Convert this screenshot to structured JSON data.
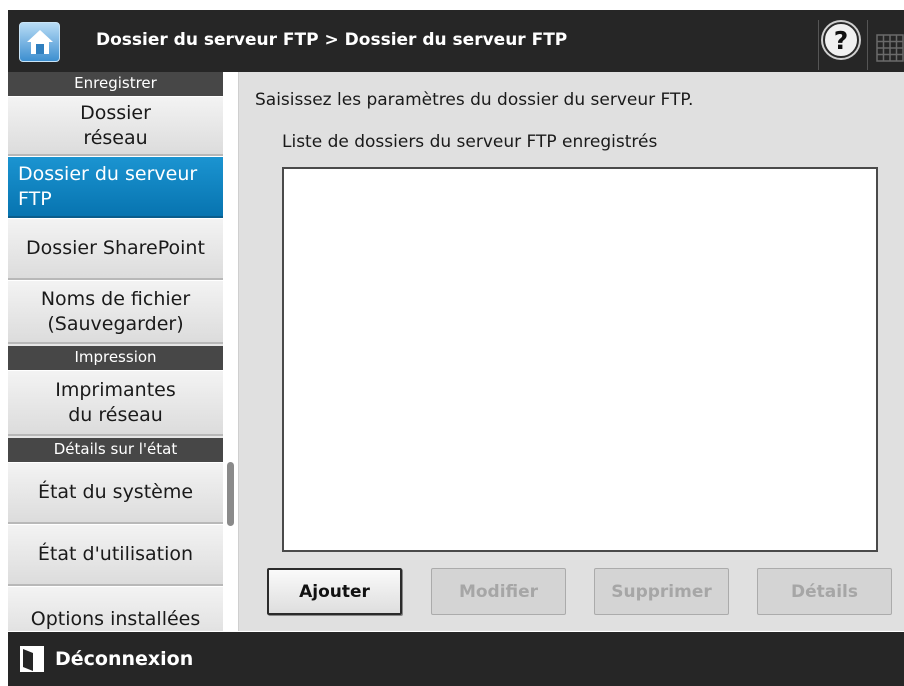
{
  "header": {
    "breadcrumb": "Dossier du serveur FTP  >  Dossier du serveur FTP",
    "help_symbol": "?",
    "icons": [
      "home-icon",
      "help-icon",
      "keyboard-icon"
    ]
  },
  "sidebar": {
    "sections": [
      {
        "header": "Enregistrer",
        "items": [
          "Dossier réseau",
          "Dossier du serveur FTP",
          "Dossier SharePoint",
          "Noms de fichier (Sauvegarder)"
        ]
      },
      {
        "header": "Impression",
        "items": [
          "Imprimantes du réseau"
        ]
      },
      {
        "header": "Détails sur l'état",
        "items": [
          "État du système",
          "État d'utilisation",
          "Options installées"
        ]
      }
    ],
    "active_item": "Dossier du serveur FTP",
    "labels": {
      "enregistrer": "Enregistrer",
      "dossier_reseau_1": "Dossier",
      "dossier_reseau_2": "réseau",
      "dossier_ftp_1": "Dossier du serveur",
      "dossier_ftp_2": "FTP",
      "dossier_sharepoint": "Dossier SharePoint",
      "noms_fichier_1": "Noms de fichier",
      "noms_fichier_2": "(Sauvegarder)",
      "impression": "Impression",
      "imprimantes_1": "Imprimantes",
      "imprimantes_2": "du réseau",
      "details_etat": "Détails sur l'état",
      "etat_systeme": "État du système",
      "etat_utilisation": "État d'utilisation",
      "options_installees": "Options installées"
    }
  },
  "main": {
    "instruction": "Saisissez les paramètres du dossier du serveur FTP.",
    "list_label": "Liste de dossiers du serveur FTP enregistrés",
    "list_items": [],
    "buttons": {
      "add": "Ajouter",
      "modify": "Modifier",
      "delete": "Supprimer",
      "details": "Détails"
    }
  },
  "footer": {
    "logout_label": "Déconnexion"
  },
  "colors": {
    "bar": "#262626",
    "active": "#0a84c2",
    "panel": "#e0e0e0",
    "section_header": "#474747"
  }
}
